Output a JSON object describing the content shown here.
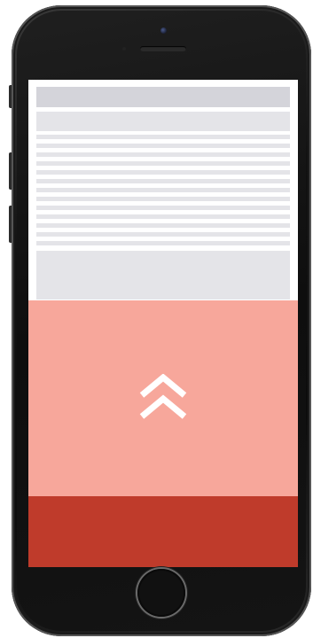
{
  "device": {
    "model": "smartphone"
  },
  "screen": {
    "skeleton_line_count": 13,
    "pull_up_handle_icon": "double-chevron-up-icon",
    "colors": {
      "tray": "#f7a79b",
      "bottom_bar": "#bf3b2b",
      "skeleton": "#e4e4e8",
      "skeleton_header": "#d4d4da",
      "icon": "#ffffff"
    }
  }
}
